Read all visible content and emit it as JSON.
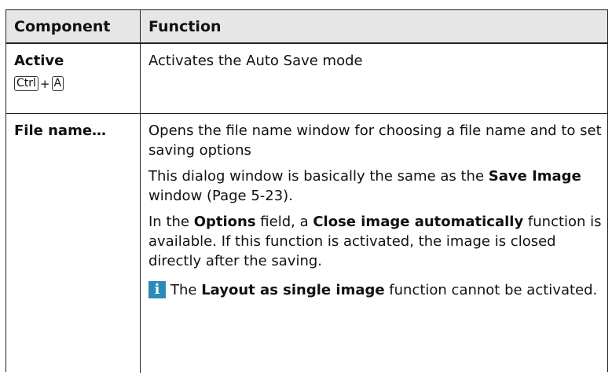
{
  "header": {
    "component": "Component",
    "function": "Function"
  },
  "rows": [
    {
      "component": "Active",
      "shortcut": {
        "key1": "Ctrl",
        "plus": "+",
        "key2": "A"
      },
      "function": "Activates the Auto Save mode"
    },
    {
      "component": "File name…",
      "function_1": "Opens the file name window for choosing a file name and to set saving options",
      "function_2": {
        "prefix": "This dialog window is basically the same as the ",
        "bold": "Save Image",
        "suffix": " window (Page 5-23)."
      },
      "function_3": {
        "t1": "In the ",
        "b1": "Options",
        "t2": " field, a ",
        "b2": "Close image automatically",
        "t3": " function is available. If this function is activated, the image is closed directly after the saving."
      },
      "note": {
        "icon": "info-icon",
        "icon_glyph": "i",
        "t1": "The ",
        "b1": "Layout as single image",
        "t2": " function cannot be activated."
      }
    }
  ],
  "colors": {
    "header_bg": "#e6e6e6",
    "info_icon_bg": "#2a8ab8"
  }
}
